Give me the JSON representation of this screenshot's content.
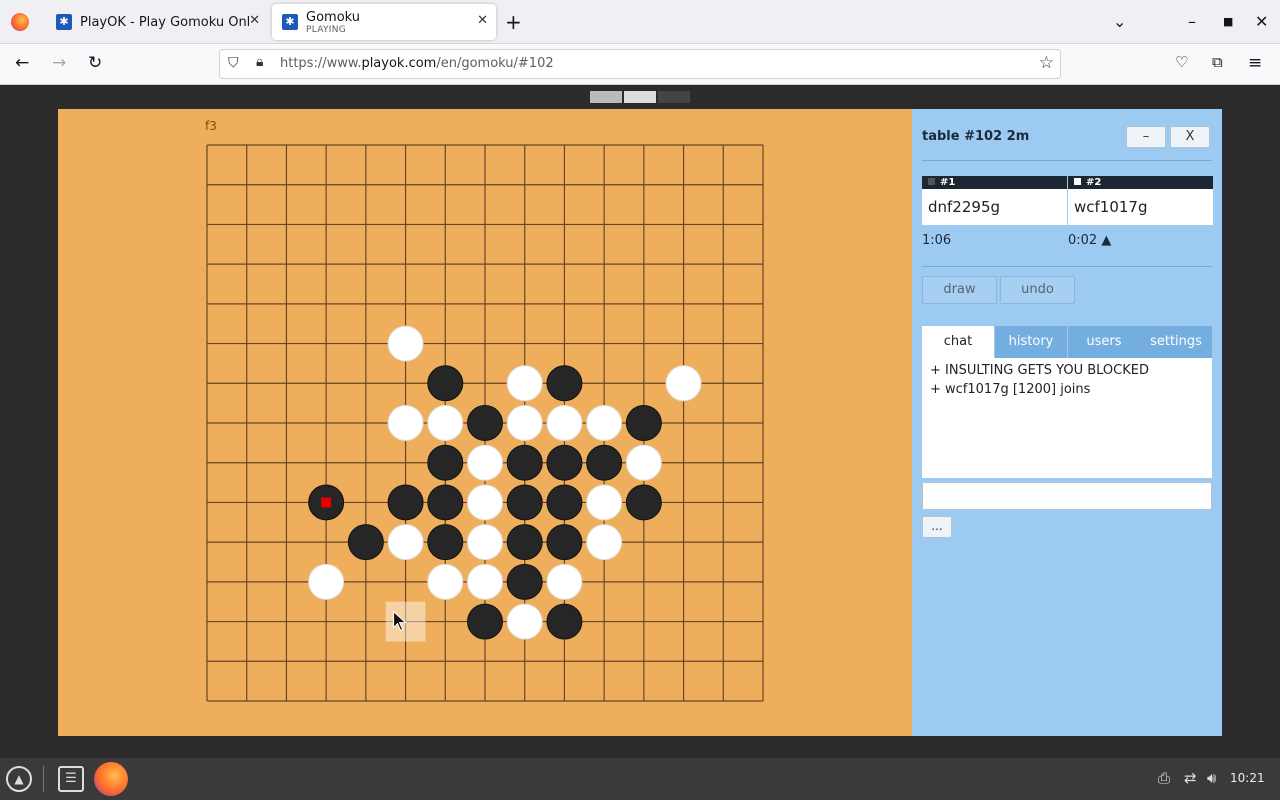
{
  "browser": {
    "tabs": [
      {
        "title": "PlayOK - Play Gomoku Online",
        "subtitle": "",
        "active": false
      },
      {
        "title": "Gomoku",
        "subtitle": "PLAYING",
        "active": true
      }
    ],
    "url_prefix": "https://www.",
    "url_domain": "playok.com",
    "url_path": "/en/gomoku/#102"
  },
  "board": {
    "coord_label": "f3",
    "size": 15,
    "colors": {
      "board": "#efae5c",
      "line": "#6b4424",
      "black": "#262626",
      "white": "#ffffff",
      "last_move": "#e60000"
    },
    "stones": [
      {
        "col": 5,
        "row": 5,
        "color": "white"
      },
      {
        "col": 6,
        "row": 6,
        "color": "black"
      },
      {
        "col": 8,
        "row": 6,
        "color": "white"
      },
      {
        "col": 9,
        "row": 6,
        "color": "black"
      },
      {
        "col": 12,
        "row": 6,
        "color": "white"
      },
      {
        "col": 5,
        "row": 7,
        "color": "white"
      },
      {
        "col": 6,
        "row": 7,
        "color": "white"
      },
      {
        "col": 7,
        "row": 7,
        "color": "black"
      },
      {
        "col": 8,
        "row": 7,
        "color": "white"
      },
      {
        "col": 9,
        "row": 7,
        "color": "white"
      },
      {
        "col": 10,
        "row": 7,
        "color": "white"
      },
      {
        "col": 11,
        "row": 7,
        "color": "black"
      },
      {
        "col": 6,
        "row": 8,
        "color": "black"
      },
      {
        "col": 7,
        "row": 8,
        "color": "white"
      },
      {
        "col": 8,
        "row": 8,
        "color": "black"
      },
      {
        "col": 9,
        "row": 8,
        "color": "black"
      },
      {
        "col": 10,
        "row": 8,
        "color": "black"
      },
      {
        "col": 11,
        "row": 8,
        "color": "white"
      },
      {
        "col": 3,
        "row": 9,
        "color": "black",
        "last": true
      },
      {
        "col": 5,
        "row": 9,
        "color": "black"
      },
      {
        "col": 6,
        "row": 9,
        "color": "black"
      },
      {
        "col": 7,
        "row": 9,
        "color": "white"
      },
      {
        "col": 8,
        "row": 9,
        "color": "black"
      },
      {
        "col": 9,
        "row": 9,
        "color": "black"
      },
      {
        "col": 10,
        "row": 9,
        "color": "white"
      },
      {
        "col": 11,
        "row": 9,
        "color": "black"
      },
      {
        "col": 4,
        "row": 10,
        "color": "black"
      },
      {
        "col": 5,
        "row": 10,
        "color": "white"
      },
      {
        "col": 6,
        "row": 10,
        "color": "black"
      },
      {
        "col": 7,
        "row": 10,
        "color": "white"
      },
      {
        "col": 8,
        "row": 10,
        "color": "black"
      },
      {
        "col": 9,
        "row": 10,
        "color": "black"
      },
      {
        "col": 10,
        "row": 10,
        "color": "white"
      },
      {
        "col": 3,
        "row": 11,
        "color": "white"
      },
      {
        "col": 6,
        "row": 11,
        "color": "white"
      },
      {
        "col": 7,
        "row": 11,
        "color": "white"
      },
      {
        "col": 8,
        "row": 11,
        "color": "black"
      },
      {
        "col": 9,
        "row": 11,
        "color": "white"
      },
      {
        "col": 7,
        "row": 12,
        "color": "black"
      },
      {
        "col": 8,
        "row": 12,
        "color": "white"
      },
      {
        "col": 9,
        "row": 12,
        "color": "black"
      }
    ],
    "hover_cell": {
      "col": 5,
      "row": 12
    }
  },
  "side": {
    "table_title": "table #102   2m",
    "min_label": "–",
    "close_label": "X",
    "players": [
      {
        "seat": "#1",
        "name": "dnf2295g",
        "time": "1:06",
        "stone": "black"
      },
      {
        "seat": "#2",
        "name": "wcf1017g",
        "time": "0:02  ▲",
        "stone": "white"
      }
    ],
    "draw_label": "draw",
    "undo_label": "undo",
    "tabs": [
      "chat",
      "history",
      "users",
      "settings"
    ],
    "chat_lines": [
      "+ INSULTING GETS YOU BLOCKED",
      "+ wcf1017g [1200] joins"
    ],
    "more_label": "..."
  },
  "taskbar": {
    "clock": "10:21"
  }
}
